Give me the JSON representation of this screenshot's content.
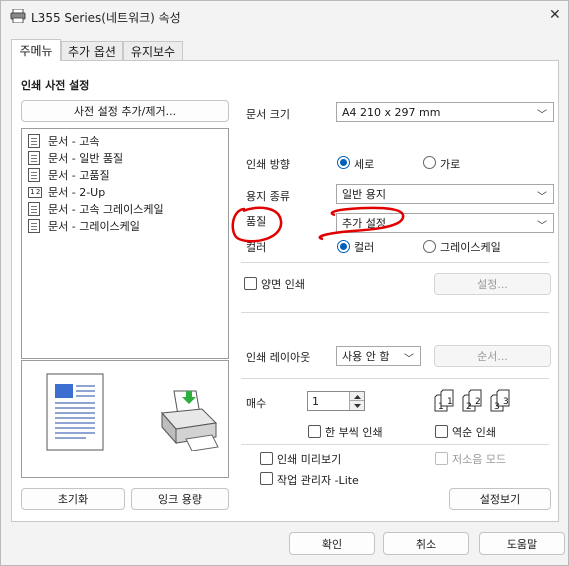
{
  "window": {
    "title": "L355 Series(네트워크) 속성",
    "close_glyph": "✕"
  },
  "tabs": [
    {
      "label": "주메뉴",
      "active": true
    },
    {
      "label": "추가 옵션",
      "active": false
    },
    {
      "label": "유지보수",
      "active": false
    }
  ],
  "presets": {
    "section_title": "인쇄 사전 설정",
    "manage_button": "사전 설정 추가/제거...",
    "items": [
      {
        "label": "문서 - 고속"
      },
      {
        "label": "문서 - 일반 품질"
      },
      {
        "label": "문서 - 고품질"
      },
      {
        "label": "문서 - 2-Up",
        "icon_text": "1 2"
      },
      {
        "label": "문서 - 고속 그레이스케일"
      },
      {
        "label": "문서 - 그레이스케일"
      }
    ]
  },
  "left_buttons": {
    "reset": "초기화",
    "ink_level": "잉크 용량"
  },
  "settings": {
    "paper_size": {
      "label": "문서 크기",
      "value": "A4 210 x 297 mm"
    },
    "orientation": {
      "label": "인쇄 방향",
      "options": [
        "세로",
        "가로"
      ],
      "selected": "세로"
    },
    "paper_type": {
      "label": "용지 종류",
      "value": "일반 용지"
    },
    "quality": {
      "label": "품질",
      "value": "추가 설정"
    },
    "color": {
      "label": "컬러",
      "options": [
        "컬러",
        "그레이스케일"
      ],
      "selected": "컬러"
    },
    "duplex": {
      "label": "양면 인쇄",
      "checked": false,
      "settings_button": "설정..."
    },
    "layout": {
      "label": "인쇄 레이아웃",
      "value": "사용 안 함",
      "order_button": "순서..."
    },
    "copies": {
      "label": "매수",
      "value": "1"
    },
    "collate": {
      "label": "한 부씩 인쇄",
      "checked": false
    },
    "reverse": {
      "label": "역순 인쇄",
      "checked": false
    },
    "preview": {
      "label": "인쇄 미리보기",
      "checked": false
    },
    "quiet_mode": {
      "label": "저소음 모드",
      "checked": false,
      "disabled": true
    },
    "job_arranger": {
      "label": "작업 관리자 -Lite",
      "checked": false
    },
    "show_settings_button": "설정보기"
  },
  "footer": {
    "ok": "확인",
    "cancel": "취소",
    "help": "도움말"
  },
  "colors": {
    "accent": "#005fb8",
    "annotation_red": "#e00000"
  }
}
